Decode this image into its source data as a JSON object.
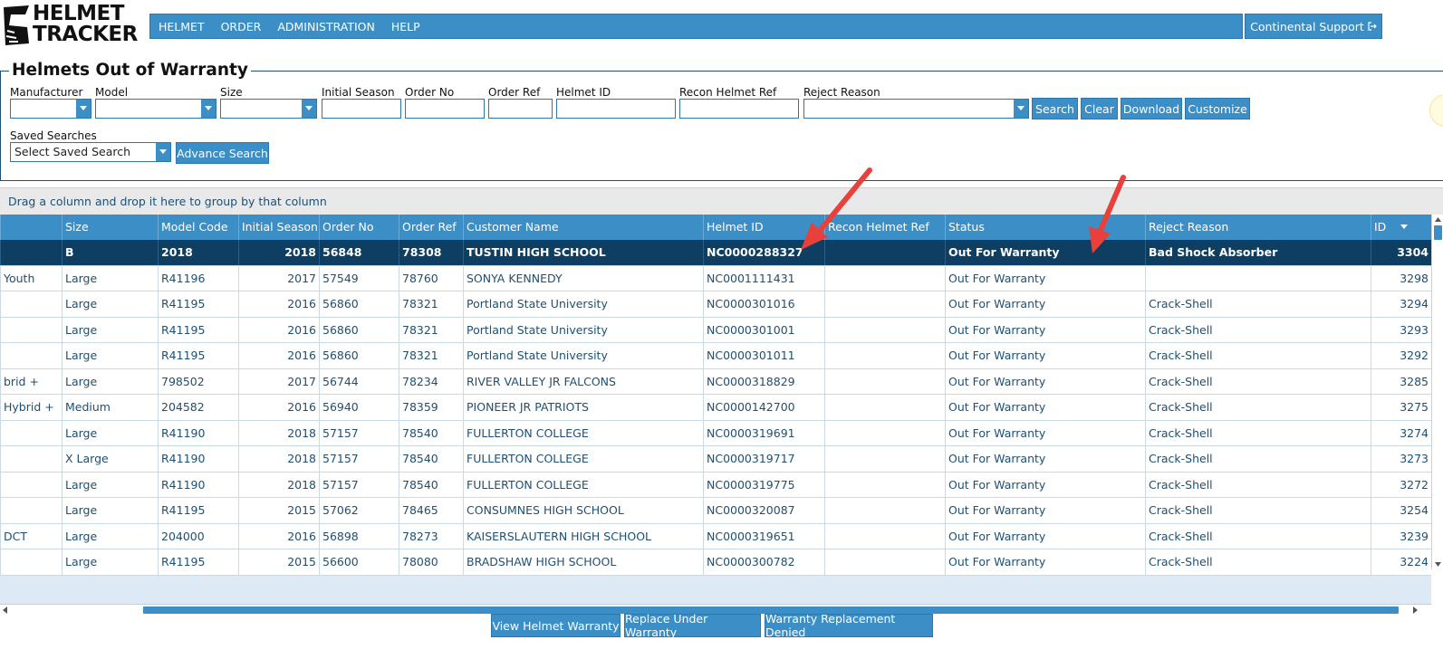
{
  "logo": {
    "line1": "HELMET",
    "line2": "TRACKER"
  },
  "nav": {
    "items": [
      "HELMET",
      "ORDER",
      "ADMINISTRATION",
      "HELP"
    ],
    "support_label": "Continental Support"
  },
  "search": {
    "title": "Helmets Out of Warranty",
    "labels": {
      "manufacturer": "Manufacturer",
      "model": "Model",
      "size": "Size",
      "initial_season": "Initial Season",
      "order_no": "Order No",
      "order_ref": "Order Ref",
      "helmet_id": "Helmet ID",
      "recon_helmet_ref": "Recon Helmet Ref",
      "reject_reason": "Reject Reason",
      "saved_searches": "Saved Searches"
    },
    "saved_search_value": "Select Saved Search",
    "buttons": {
      "search": "Search",
      "clear": "Clear",
      "download": "Download",
      "customize": "Customize",
      "advance_search": "Advance Search"
    }
  },
  "grid": {
    "group_hint": "Drag a column and drop it here to group by that column",
    "columns": [
      "",
      "Size",
      "Model Code",
      "Initial Season",
      "Order No",
      "Order Ref",
      "Customer Name",
      "Helmet ID",
      "Recon Helmet Ref",
      "Status",
      "Reject Reason",
      "ID"
    ],
    "rows": [
      [
        "",
        "B",
        "2018",
        "2018",
        "56848",
        "78308",
        "TUSTIN HIGH SCHOOL",
        "NC0000288327",
        "",
        "Out For Warranty",
        "Bad Shock Absorber",
        "3304"
      ],
      [
        "Youth",
        "Large",
        "R41196",
        "2017",
        "57549",
        "78760",
        "SONYA KENNEDY",
        "NC0001111431",
        "",
        "Out For Warranty",
        "",
        "3298"
      ],
      [
        "",
        "Large",
        "R41195",
        "2016",
        "56860",
        "78321",
        "Portland State University",
        "NC0000301016",
        "",
        "Out For Warranty",
        "Crack-Shell",
        "3294"
      ],
      [
        "",
        "Large",
        "R41195",
        "2016",
        "56860",
        "78321",
        "Portland State University",
        "NC0000301001",
        "",
        "Out For Warranty",
        "Crack-Shell",
        "3293"
      ],
      [
        "",
        "Large",
        "R41195",
        "2016",
        "56860",
        "78321",
        "Portland State University",
        "NC0000301011",
        "",
        "Out For Warranty",
        "Crack-Shell",
        "3292"
      ],
      [
        "brid +",
        "Large",
        "798502",
        "2017",
        "56744",
        "78234",
        "RIVER VALLEY JR FALCONS",
        "NC0000318829",
        "",
        "Out For Warranty",
        "Crack-Shell",
        "3285"
      ],
      [
        " Hybrid +",
        "Medium",
        "204582",
        "2016",
        "56940",
        "78359",
        "PIONEER JR PATRIOTS",
        "NC0000142700",
        "",
        "Out For Warranty",
        "Crack-Shell",
        "3275"
      ],
      [
        "",
        "Large",
        "R41190",
        "2018",
        "57157",
        "78540",
        "FULLERTON COLLEGE",
        "NC0000319691",
        "",
        "Out For Warranty",
        "Crack-Shell",
        "3274"
      ],
      [
        "",
        "X Large",
        "R41190",
        "2018",
        "57157",
        "78540",
        "FULLERTON COLLEGE",
        "NC0000319717",
        "",
        "Out For Warranty",
        "Crack-Shell",
        "3273"
      ],
      [
        "",
        "Large",
        "R41190",
        "2018",
        "57157",
        "78540",
        "FULLERTON COLLEGE",
        "NC0000319775",
        "",
        "Out For Warranty",
        "Crack-Shell",
        "3272"
      ],
      [
        "",
        "Large",
        "R41195",
        "2015",
        "57062",
        "78465",
        "CONSUMNES HIGH SCHOOL",
        "NC0000320087",
        "",
        "Out For Warranty",
        "Crack-Shell",
        "3254"
      ],
      [
        " DCT",
        "Large",
        "204000",
        "2016",
        "56898",
        "78273",
        "KAISERSLAUTERN HIGH SCHOOL",
        "NC0000319651",
        "",
        "Out For Warranty",
        "Crack-Shell",
        "3239"
      ],
      [
        "",
        "Large",
        "R41195",
        "2015",
        "56600",
        "78080",
        "BRADSHAW HIGH SCHOOL",
        "NC0000300782",
        "",
        "Out For Warranty",
        "Crack-Shell",
        "3224"
      ]
    ]
  },
  "footer_buttons": [
    "View Helmet Warranty",
    "Replace Under Warranty",
    "Warranty Replacement Denied"
  ],
  "colors": {
    "primary": "#3b8fc6",
    "selected_row": "#0f3e63",
    "annotation_arrow": "#e8403a"
  }
}
